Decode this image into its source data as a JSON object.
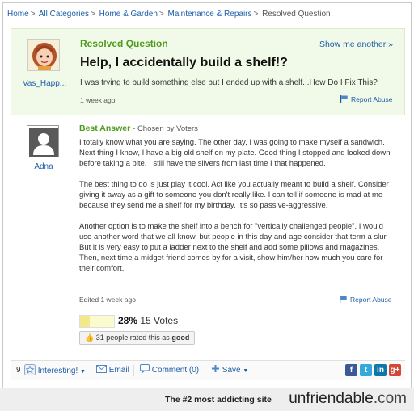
{
  "breadcrumb": {
    "home": "Home",
    "all_categories": "All Categories",
    "home_garden": "Home & Garden",
    "maintenance": "Maintenance & Repairs",
    "current": "Resolved Question",
    "separator": ">"
  },
  "question": {
    "section_label": "Resolved Question",
    "show_more": "Show me another »",
    "title": "Help, I accidentally build a shelf!?",
    "body": "I was trying to build something else but I ended up with a shelf...How Do I Fix This?",
    "time": "1 week ago",
    "report": "Report Abuse",
    "user": "Vas_Happ..."
  },
  "answer": {
    "label": "Best Answer",
    "chosen": "- Chosen by Voters",
    "user": "Adna",
    "paragraphs": [
      "I totally know what you are saying. The other day, I was going to make myself a sandwich. Next thing I know, I have a big old shelf on my plate. Good thing I stopped and looked down before taking a bite. I still have the slivers from last time I that happened.",
      "The best thing to do is just play it cool. Act like you actually meant to build a shelf. Consider giving it away as a gift to someone you don't really like. I can tell if someone is mad at me because they send me a shelf for my birthday. It's so passive-aggressive.",
      "Another option is to make the shelf into a bench for \"vertically challenged people\". I would use another word that we all know, but people in this day and age consider that term a slur. But it is very easy to put a ladder next to the shelf and add some pillows and magazines. Then, next time a midget friend comes by for a visit, show him/her how much you care for their comfort."
    ],
    "edited": "Edited 1 week ago",
    "report": "Report Abuse",
    "vote_percent": "28%",
    "vote_fraction": 0.28,
    "votes": "15 Votes",
    "rated_prefix": "31 people rated this as",
    "rated_word": "good"
  },
  "toolbar": {
    "interesting_count": "9",
    "interesting": "Interesting!",
    "email": "Email",
    "comment": "Comment (0)",
    "save": "Save",
    "social_icons": [
      "facebook-icon",
      "twitter-icon",
      "linkedin-icon",
      "googleplus-icon"
    ]
  },
  "footer": {
    "tagline": "The #2 most addicting site",
    "brand_prefix": "unfriendable",
    "brand_suffix": ".com"
  },
  "colors": {
    "accent_green": "#4e9a1c",
    "link_blue": "#1e5fa8",
    "question_bg": "#f1f9e8"
  }
}
